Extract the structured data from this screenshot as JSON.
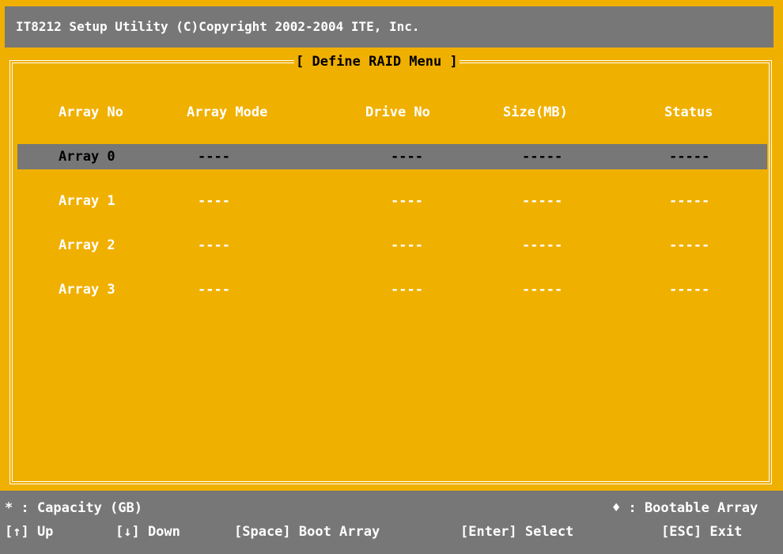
{
  "title": "IT8212 Setup Utility (C)Copyright 2002-2004 ITE, Inc.",
  "menu_title": "[ Define RAID Menu ]",
  "columns": [
    "Array No",
    "Array Mode",
    "Drive No",
    "Size(MB)",
    "Status"
  ],
  "rows": [
    {
      "array": "Array 0",
      "mode": "----",
      "drive": "----",
      "size": "-----",
      "status": "-----",
      "selected": true
    },
    {
      "array": "Array 1",
      "mode": "----",
      "drive": "----",
      "size": "-----",
      "status": "-----",
      "selected": false
    },
    {
      "array": "Array 2",
      "mode": "----",
      "drive": "----",
      "size": "-----",
      "status": "-----",
      "selected": false
    },
    {
      "array": "Array 3",
      "mode": "----",
      "drive": "----",
      "size": "-----",
      "status": "-----",
      "selected": false
    }
  ],
  "legend": {
    "capacity": "* : Capacity (GB)",
    "bootable": "♦ : Bootable Array"
  },
  "keys": {
    "up": "[↑] Up",
    "down": "[↓] Down",
    "space": "[Space] Boot Array",
    "enter": "[Enter] Select",
    "esc": "[ESC] Exit"
  },
  "colors": {
    "background": "#f0b000",
    "bar": "#777777",
    "text": "#ffffff",
    "selected_text": "#000000"
  }
}
